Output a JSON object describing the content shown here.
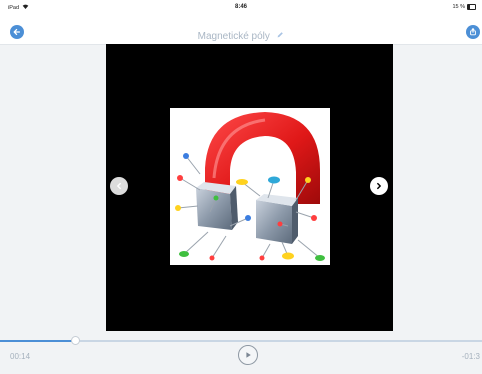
{
  "status_bar": {
    "device": "iPad",
    "wifi_icon": "wifi-icon",
    "time": "8:46",
    "battery": "15 %"
  },
  "header": {
    "title": "Magnetické póly",
    "back_icon": "back-arrow-icon",
    "edit_icon": "pencil-icon",
    "action_icon": "share-icon"
  },
  "viewer": {
    "image_description_icon": "horseshoe-magnet-image",
    "prev_icon": "chevron-left-icon",
    "next_icon": "chevron-right-icon"
  },
  "player": {
    "elapsed": "00:14",
    "remaining": "-01:3",
    "progress_fraction": 0.155,
    "play_icon": "play-icon"
  },
  "colors": {
    "accent": "#4c8fd6",
    "title": "#a9b6c4",
    "background": "#f1f3f5",
    "stage": "#000000"
  }
}
